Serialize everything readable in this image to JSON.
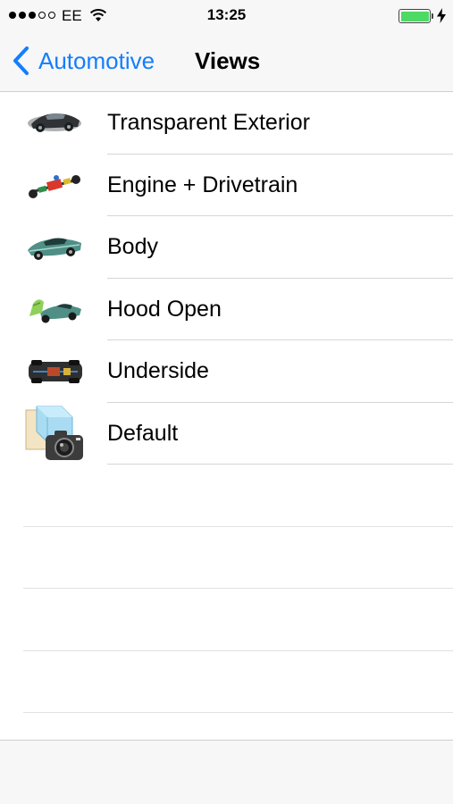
{
  "status_bar": {
    "carrier": "EE",
    "time": "13:25",
    "battery_level": 1.0,
    "battery_color": "#4cd964",
    "signal_dots": {
      "filled": 3,
      "total": 5
    }
  },
  "nav": {
    "back_label": "Automotive",
    "title": "Views",
    "accent_color": "#147efb"
  },
  "views": [
    {
      "label": "Transparent Exterior",
      "icon": "transparent-car-thumbnail"
    },
    {
      "label": "Engine + Drivetrain",
      "icon": "drivetrain-thumbnail"
    },
    {
      "label": "Body",
      "icon": "car-body-thumbnail"
    },
    {
      "label": "Hood Open",
      "icon": "hood-open-thumbnail"
    },
    {
      "label": "Underside",
      "icon": "underside-thumbnail"
    },
    {
      "label": "Default",
      "icon": "camera-cube-icon"
    }
  ]
}
